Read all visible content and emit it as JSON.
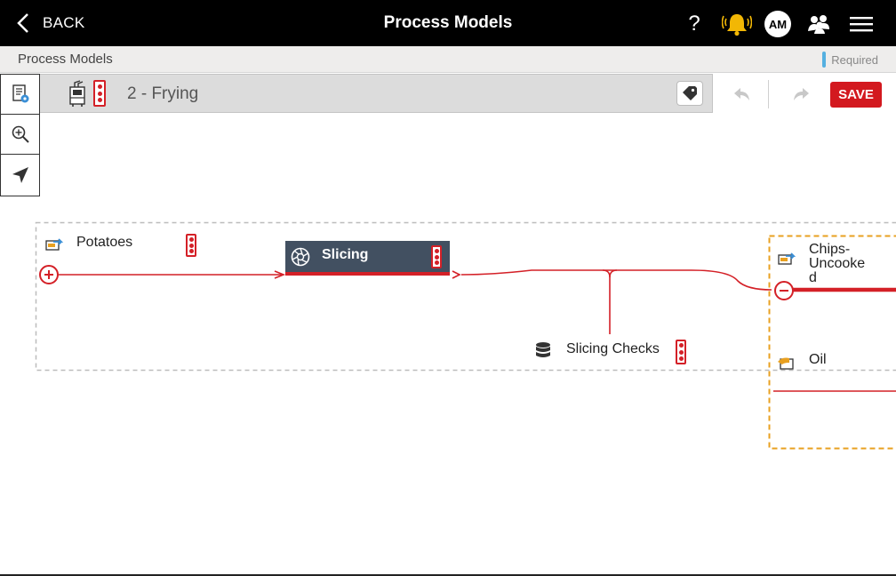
{
  "topbar": {
    "back_label": "BACK",
    "title": "Process Models",
    "help_label": "?",
    "avatar_initials": "AM"
  },
  "breadcrumb": {
    "label": "Process Models",
    "required_label": "Required"
  },
  "process": {
    "title": "2 - Frying"
  },
  "actions": {
    "save_label": "SAVE"
  },
  "nodes": {
    "potatoes": "Potatoes",
    "slicing": "Slicing",
    "slicing_checks": "Slicing Checks",
    "chips_line1": "Chips-Uncooke",
    "chips_line2": "d",
    "oil": "Oil"
  },
  "colors": {
    "accent_red": "#d42027",
    "node_dark": "#425061",
    "bell_yellow": "#f2b705",
    "required_blue": "#55b0e0",
    "orange_group": "#e8a020"
  }
}
